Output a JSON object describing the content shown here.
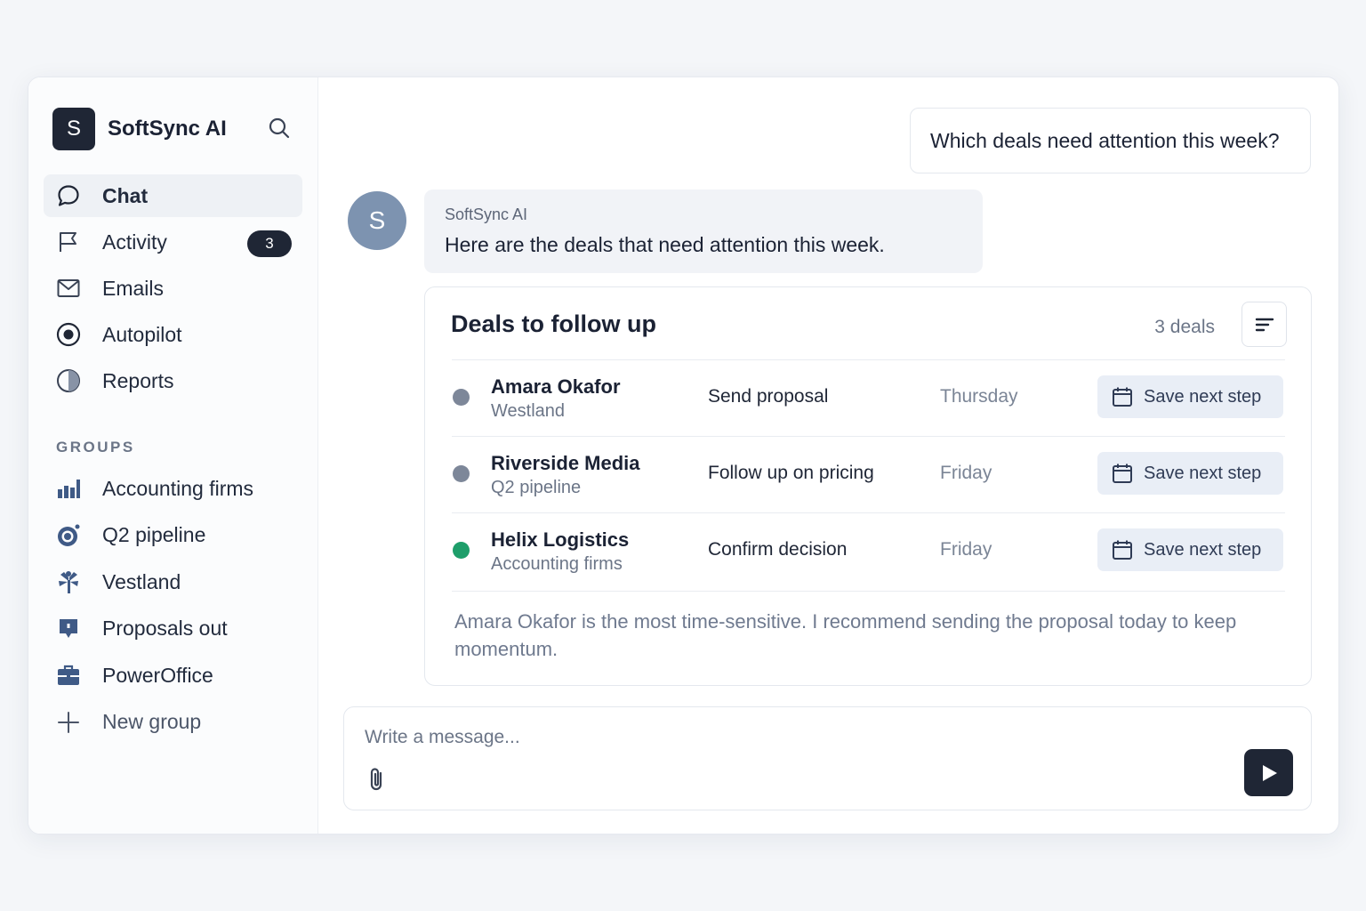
{
  "app": {
    "logo_letter": "S",
    "name": "SoftSync AI"
  },
  "nav": {
    "items": [
      {
        "label": "Chat",
        "icon": "chat-bubble-icon",
        "active": true
      },
      {
        "label": "Activity",
        "icon": "flag-icon",
        "badge": "3"
      },
      {
        "label": "Emails",
        "icon": "mail-icon"
      },
      {
        "label": "Autopilot",
        "icon": "target-icon"
      },
      {
        "label": "Reports",
        "icon": "pie-chart-icon"
      }
    ]
  },
  "groups": {
    "heading": "GROUPS",
    "items": [
      {
        "label": "Accounting firms",
        "icon": "bar-chart-icon"
      },
      {
        "label": "Q2 pipeline",
        "icon": "target-ring-icon"
      },
      {
        "label": "Vestland",
        "icon": "tree-icon"
      },
      {
        "label": "Proposals out",
        "icon": "comment-box-icon"
      },
      {
        "label": "PowerOffice",
        "icon": "briefcase-icon"
      }
    ],
    "new_label": "New group"
  },
  "chat": {
    "user_message": "Which deals need attention this week?",
    "ai_avatar_letter": "S",
    "ai_sender": "SoftSync AI",
    "ai_message": "Here are the deals that need attention this week."
  },
  "deals_card": {
    "title": "Deals to follow up",
    "count_label": "3 deals",
    "rows": [
      {
        "name": "Amara Okafor",
        "group": "Westland",
        "action": "Send proposal",
        "day": "Thursday",
        "button": "Save next step",
        "status_color": "#7d8799"
      },
      {
        "name": "Riverside Media",
        "group": "Q2 pipeline",
        "action": "Follow up on pricing",
        "day": "Friday",
        "button": "Save next step",
        "status_color": "#7d8799"
      },
      {
        "name": "Helix Logistics",
        "group": "Accounting firms",
        "action": "Confirm decision",
        "day": "Friday",
        "button": "Save next step",
        "status_color": "#1e9e6a"
      }
    ],
    "summary": "Amara Okafor is the most time-sensitive. I recommend sending the proposal today to keep momentum."
  },
  "composer": {
    "placeholder": "Write a message..."
  }
}
